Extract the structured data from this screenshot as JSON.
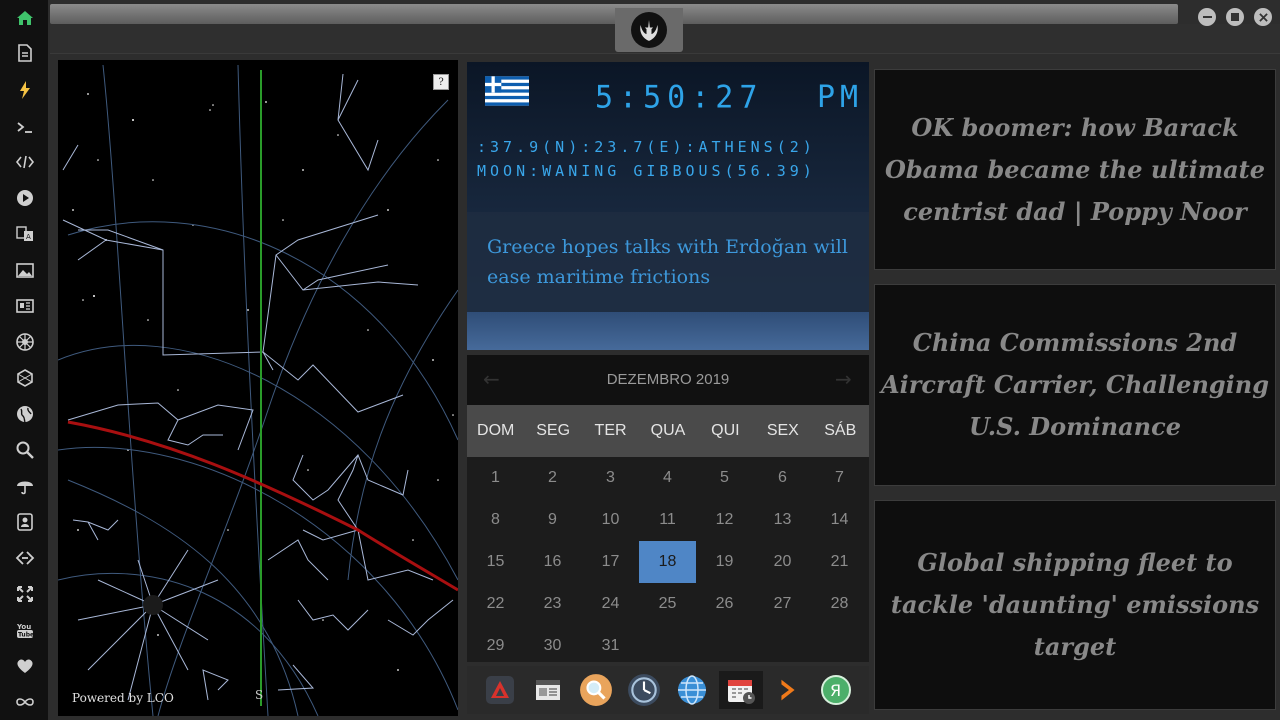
{
  "sidebar": {
    "items": [
      {
        "icon": "home-icon"
      },
      {
        "icon": "document-icon"
      },
      {
        "icon": "lightning-icon"
      },
      {
        "icon": "terminal-icon"
      },
      {
        "icon": "code-icon"
      },
      {
        "icon": "play-icon"
      },
      {
        "icon": "translate-icon"
      },
      {
        "icon": "image-icon"
      },
      {
        "icon": "newspaper-icon"
      },
      {
        "icon": "galactic-empire-icon"
      },
      {
        "icon": "hexagon-icon"
      },
      {
        "icon": "globe-icon"
      },
      {
        "icon": "search-icon"
      },
      {
        "icon": "umbrella-icon"
      },
      {
        "icon": "contacts-icon"
      },
      {
        "icon": "link-icon"
      },
      {
        "icon": "expand-icon"
      },
      {
        "icon": "youtube-icon"
      },
      {
        "icon": "heart-icon"
      },
      {
        "icon": "infinity-icon"
      }
    ],
    "active_color": "#3fc36b",
    "accent_color": "#f6c445"
  },
  "window": {
    "logo_icon": "rebel-alliance-icon",
    "controls": [
      "minimize-icon",
      "maximize-icon",
      "close-icon"
    ]
  },
  "skymap": {
    "help_label": "?",
    "powered_by": "Powered by LCO",
    "south_label": "S"
  },
  "clock": {
    "flag_icon": "greece-flag-icon",
    "time": "5:50:27",
    "ampm": "PM",
    "location_line": ":37.9(N):23.7(E):ATHENS(2)",
    "moon_line": "MOON:WANING GIBBOUS(56.39)",
    "headline": "Greece hopes talks with Erdoğan will ease maritime frictions",
    "digit_color": "#2ea3e8"
  },
  "calendar": {
    "title": "DEZEMBRO 2019",
    "prev_label": "←",
    "next_label": "→",
    "weekdays": [
      "DOM",
      "SEG",
      "TER",
      "QUA",
      "QUI",
      "SEX",
      "SÁB"
    ],
    "days": [
      "1",
      "2",
      "3",
      "4",
      "5",
      "6",
      "7",
      "8",
      "9",
      "10",
      "11",
      "12",
      "13",
      "14",
      "15",
      "16",
      "17",
      "18",
      "19",
      "20",
      "21",
      "22",
      "23",
      "24",
      "25",
      "26",
      "27",
      "28",
      "29",
      "30",
      "31"
    ],
    "today": "18",
    "today_color": "#4f86c6"
  },
  "dock": {
    "items": [
      {
        "icon": "app-red-triangle-icon"
      },
      {
        "icon": "news-reader-icon"
      },
      {
        "icon": "magnifier-app-icon"
      },
      {
        "icon": "clock-app-icon"
      },
      {
        "icon": "browser-globe-icon"
      },
      {
        "icon": "calendar-app-icon"
      },
      {
        "icon": "arrow-app-icon"
      },
      {
        "icon": "yandex-icon"
      }
    ]
  },
  "news": [
    {
      "headline": "OK boomer: how Barack Obama became the ultimate centrist dad | Poppy Noor"
    },
    {
      "headline": "China Commissions 2nd Aircraft Carrier, Challenging U.S. Dominance"
    },
    {
      "headline": "Global shipping fleet to tackle 'daunting' emissions target"
    }
  ]
}
